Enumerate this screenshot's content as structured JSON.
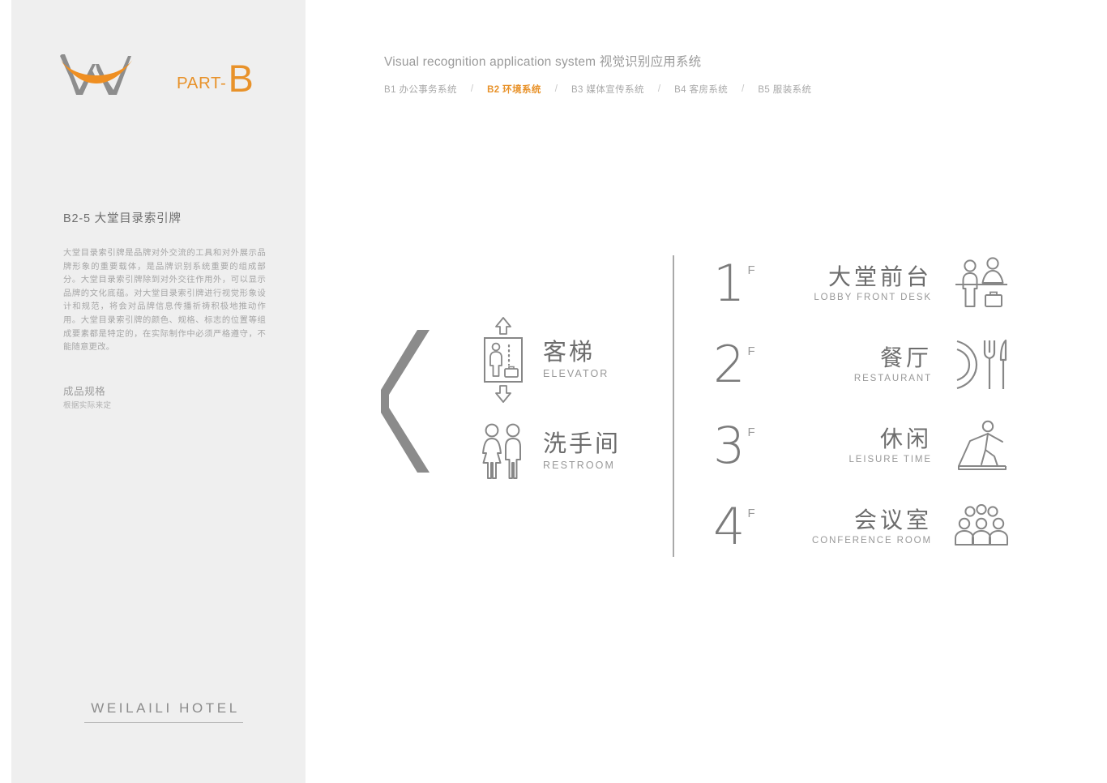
{
  "brand": {
    "logo_icon": "w-swoosh-logo",
    "part_word": "PART-",
    "part_letter": "B",
    "footer_name": "WEILAILI HOTEL"
  },
  "colors": {
    "accent": "#e8922a",
    "panel_bg": "#efefef",
    "gray_text": "#6d6d6d",
    "light_gray_text": "#a6a6a6",
    "icon_gray": "#7b7b7b"
  },
  "sidebar": {
    "section_title": "B2-5 大堂目录索引牌",
    "description": "大堂目录索引牌是品牌对外交流的工具和对外展示品牌形象的重要载体，是品牌识别系统重要的组成部分。大堂目录索引牌除到对外交往作用外，可以显示品牌的文化底蕴。对大堂目录索引牌进行视觉形象设计和规范，将会对品牌信息传播祈祷积极地推动作用。大堂目录索引牌的颜色、规格、标志的位置等组成要素都是特定的，在实际制作中必须严格遵守，不能随意更改。",
    "spec_label": "成品规格",
    "spec_value": "根据实际来定"
  },
  "header": {
    "title": "Visual recognition application system 视觉识别应用系统",
    "separator": "/",
    "nav": [
      {
        "label": "B1 办公事务系统",
        "active": false
      },
      {
        "label": "B2 环境系统",
        "active": true
      },
      {
        "label": "B3 媒体宣传系统",
        "active": false
      },
      {
        "label": "B4 客房系统",
        "active": false
      },
      {
        "label": "B5 服装系统",
        "active": false
      }
    ]
  },
  "sign": {
    "direction_icon": "chevron-left-arrow",
    "left_column": [
      {
        "cn": "客梯",
        "en": "ELEVATOR",
        "icon": "elevator-icon"
      },
      {
        "cn": "洗手间",
        "en": "RESTROOM",
        "icon": "restroom-icon"
      }
    ],
    "floors": [
      {
        "number": "1",
        "suffix": "F",
        "cn": "大堂前台",
        "en": "LOBBY FRONT DESK",
        "icon": "front-desk-icon"
      },
      {
        "number": "2",
        "suffix": "F",
        "cn": "餐厅",
        "en": "RESTAURANT",
        "icon": "cutlery-icon"
      },
      {
        "number": "3",
        "suffix": "F",
        "cn": "休闲",
        "en": "LEISURE TIME",
        "icon": "treadmill-icon"
      },
      {
        "number": "4",
        "suffix": "F",
        "cn": "会议室",
        "en": "CONFERENCE ROOM",
        "icon": "group-people-icon"
      }
    ]
  }
}
